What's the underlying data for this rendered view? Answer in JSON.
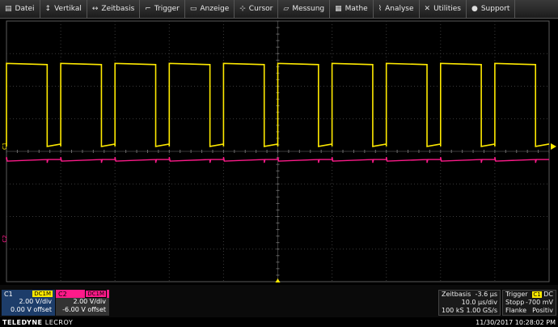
{
  "menu": [
    {
      "label": "Datei",
      "icon": "file-icon",
      "glyph": "▤"
    },
    {
      "label": "Vertikal",
      "icon": "vertical-icon",
      "glyph": "↕"
    },
    {
      "label": "Zeitbasis",
      "icon": "timebase-icon",
      "glyph": "↔"
    },
    {
      "label": "Trigger",
      "icon": "trigger-icon",
      "glyph": "⌐"
    },
    {
      "label": "Anzeige",
      "icon": "display-icon",
      "glyph": "▭"
    },
    {
      "label": "Cursor",
      "icon": "cursor-icon",
      "glyph": "⊹"
    },
    {
      "label": "Messung",
      "icon": "measure-icon",
      "glyph": "▱"
    },
    {
      "label": "Mathe",
      "icon": "math-icon",
      "glyph": "▦"
    },
    {
      "label": "Analyse",
      "icon": "analysis-icon",
      "glyph": "⌇"
    },
    {
      "label": "Utilities",
      "icon": "utilities-icon",
      "glyph": "✕"
    },
    {
      "label": "Support",
      "icon": "support-icon",
      "glyph": "●"
    }
  ],
  "channels": {
    "c1": {
      "name": "C1",
      "coupling": "DC1M",
      "vdiv": "2.00 V/div",
      "offset": "0.00 V offset",
      "color": "#ffea00"
    },
    "c2": {
      "name": "C2",
      "coupling": "DC1M",
      "vdiv": "2.00 V/div",
      "offset": "-6.00 V offset",
      "color": "#ff1a8a"
    }
  },
  "markers": {
    "c1": "C1",
    "c2": "C2"
  },
  "timebase": {
    "label": "Zeitbasis",
    "delay": "-3.6 µs",
    "tdiv": "10.0 µs/div",
    "samples": "100 kS",
    "rate": "1.00 GS/s"
  },
  "trigger": {
    "label": "Trigger",
    "source": "C1",
    "coupling": "DC",
    "mode": "Stopp",
    "level": "-700 mV",
    "slope_label": "Flanke",
    "slope": "Positiv"
  },
  "brand": {
    "name": "TELEDYNE",
    "sub": "LECROY"
  },
  "datetime": "11/30/2017 10:28:02 PM",
  "waveform": {
    "periods": 10,
    "duty": 0.75,
    "c1": {
      "high_div": 2.7,
      "low_div": 0.15,
      "color": "#ffea00"
    },
    "c2": {
      "level_div": -0.25,
      "color": "#ff1a8a"
    },
    "grid_divisions": {
      "x": 10,
      "y": 8
    }
  }
}
